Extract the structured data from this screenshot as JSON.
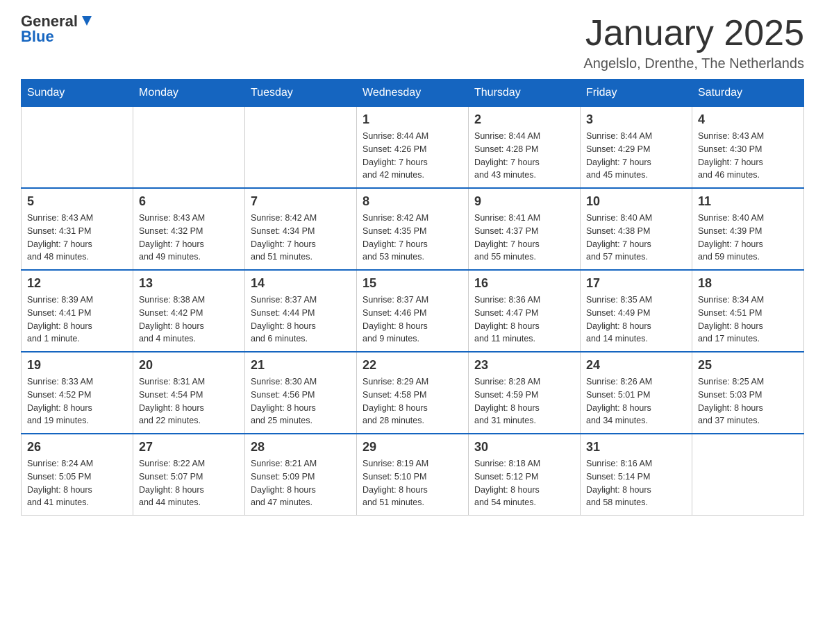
{
  "header": {
    "logo_text_general": "General",
    "logo_text_blue": "Blue",
    "title": "January 2025",
    "subtitle": "Angelslo, Drenthe, The Netherlands"
  },
  "weekdays": [
    "Sunday",
    "Monday",
    "Tuesday",
    "Wednesday",
    "Thursday",
    "Friday",
    "Saturday"
  ],
  "weeks": [
    [
      {
        "day": "",
        "info": ""
      },
      {
        "day": "",
        "info": ""
      },
      {
        "day": "",
        "info": ""
      },
      {
        "day": "1",
        "info": "Sunrise: 8:44 AM\nSunset: 4:26 PM\nDaylight: 7 hours\nand 42 minutes."
      },
      {
        "day": "2",
        "info": "Sunrise: 8:44 AM\nSunset: 4:28 PM\nDaylight: 7 hours\nand 43 minutes."
      },
      {
        "day": "3",
        "info": "Sunrise: 8:44 AM\nSunset: 4:29 PM\nDaylight: 7 hours\nand 45 minutes."
      },
      {
        "day": "4",
        "info": "Sunrise: 8:43 AM\nSunset: 4:30 PM\nDaylight: 7 hours\nand 46 minutes."
      }
    ],
    [
      {
        "day": "5",
        "info": "Sunrise: 8:43 AM\nSunset: 4:31 PM\nDaylight: 7 hours\nand 48 minutes."
      },
      {
        "day": "6",
        "info": "Sunrise: 8:43 AM\nSunset: 4:32 PM\nDaylight: 7 hours\nand 49 minutes."
      },
      {
        "day": "7",
        "info": "Sunrise: 8:42 AM\nSunset: 4:34 PM\nDaylight: 7 hours\nand 51 minutes."
      },
      {
        "day": "8",
        "info": "Sunrise: 8:42 AM\nSunset: 4:35 PM\nDaylight: 7 hours\nand 53 minutes."
      },
      {
        "day": "9",
        "info": "Sunrise: 8:41 AM\nSunset: 4:37 PM\nDaylight: 7 hours\nand 55 minutes."
      },
      {
        "day": "10",
        "info": "Sunrise: 8:40 AM\nSunset: 4:38 PM\nDaylight: 7 hours\nand 57 minutes."
      },
      {
        "day": "11",
        "info": "Sunrise: 8:40 AM\nSunset: 4:39 PM\nDaylight: 7 hours\nand 59 minutes."
      }
    ],
    [
      {
        "day": "12",
        "info": "Sunrise: 8:39 AM\nSunset: 4:41 PM\nDaylight: 8 hours\nand 1 minute."
      },
      {
        "day": "13",
        "info": "Sunrise: 8:38 AM\nSunset: 4:42 PM\nDaylight: 8 hours\nand 4 minutes."
      },
      {
        "day": "14",
        "info": "Sunrise: 8:37 AM\nSunset: 4:44 PM\nDaylight: 8 hours\nand 6 minutes."
      },
      {
        "day": "15",
        "info": "Sunrise: 8:37 AM\nSunset: 4:46 PM\nDaylight: 8 hours\nand 9 minutes."
      },
      {
        "day": "16",
        "info": "Sunrise: 8:36 AM\nSunset: 4:47 PM\nDaylight: 8 hours\nand 11 minutes."
      },
      {
        "day": "17",
        "info": "Sunrise: 8:35 AM\nSunset: 4:49 PM\nDaylight: 8 hours\nand 14 minutes."
      },
      {
        "day": "18",
        "info": "Sunrise: 8:34 AM\nSunset: 4:51 PM\nDaylight: 8 hours\nand 17 minutes."
      }
    ],
    [
      {
        "day": "19",
        "info": "Sunrise: 8:33 AM\nSunset: 4:52 PM\nDaylight: 8 hours\nand 19 minutes."
      },
      {
        "day": "20",
        "info": "Sunrise: 8:31 AM\nSunset: 4:54 PM\nDaylight: 8 hours\nand 22 minutes."
      },
      {
        "day": "21",
        "info": "Sunrise: 8:30 AM\nSunset: 4:56 PM\nDaylight: 8 hours\nand 25 minutes."
      },
      {
        "day": "22",
        "info": "Sunrise: 8:29 AM\nSunset: 4:58 PM\nDaylight: 8 hours\nand 28 minutes."
      },
      {
        "day": "23",
        "info": "Sunrise: 8:28 AM\nSunset: 4:59 PM\nDaylight: 8 hours\nand 31 minutes."
      },
      {
        "day": "24",
        "info": "Sunrise: 8:26 AM\nSunset: 5:01 PM\nDaylight: 8 hours\nand 34 minutes."
      },
      {
        "day": "25",
        "info": "Sunrise: 8:25 AM\nSunset: 5:03 PM\nDaylight: 8 hours\nand 37 minutes."
      }
    ],
    [
      {
        "day": "26",
        "info": "Sunrise: 8:24 AM\nSunset: 5:05 PM\nDaylight: 8 hours\nand 41 minutes."
      },
      {
        "day": "27",
        "info": "Sunrise: 8:22 AM\nSunset: 5:07 PM\nDaylight: 8 hours\nand 44 minutes."
      },
      {
        "day": "28",
        "info": "Sunrise: 8:21 AM\nSunset: 5:09 PM\nDaylight: 8 hours\nand 47 minutes."
      },
      {
        "day": "29",
        "info": "Sunrise: 8:19 AM\nSunset: 5:10 PM\nDaylight: 8 hours\nand 51 minutes."
      },
      {
        "day": "30",
        "info": "Sunrise: 8:18 AM\nSunset: 5:12 PM\nDaylight: 8 hours\nand 54 minutes."
      },
      {
        "day": "31",
        "info": "Sunrise: 8:16 AM\nSunset: 5:14 PM\nDaylight: 8 hours\nand 58 minutes."
      },
      {
        "day": "",
        "info": ""
      }
    ]
  ]
}
